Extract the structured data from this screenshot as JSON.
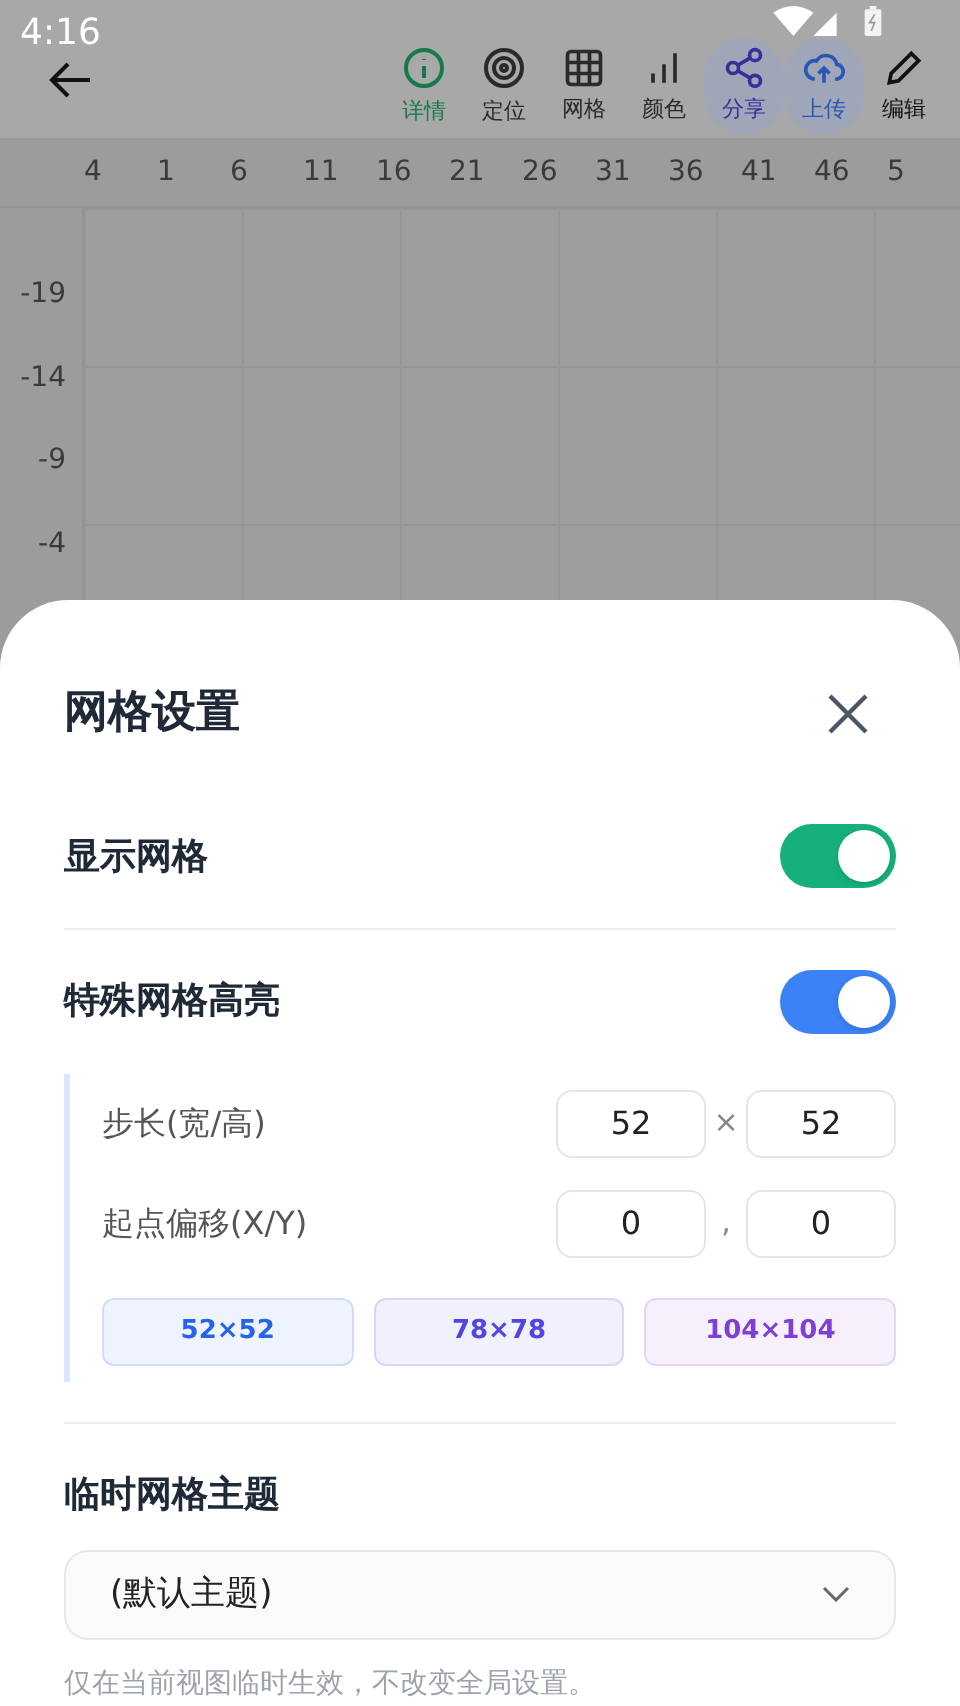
{
  "status_bar": {
    "time": "4:16"
  },
  "toolbar": {
    "items": [
      {
        "label": "详情",
        "color": "#157a47",
        "highlighted": false
      },
      {
        "label": "定位",
        "color": "#2a2a2a",
        "highlighted": false
      },
      {
        "label": "网格",
        "color": "#2a2a2a",
        "highlighted": false
      },
      {
        "label": "颜色",
        "color": "#2a2a2a",
        "highlighted": false
      },
      {
        "label": "分享",
        "color": "#35309a",
        "highlighted": true
      },
      {
        "label": "上传",
        "color": "#2857b8",
        "highlighted": true
      },
      {
        "label": "编辑",
        "color": "#111111",
        "highlighted": false
      }
    ]
  },
  "ruler": {
    "x_labels": [
      "4",
      "1",
      "6",
      "11",
      "16",
      "21",
      "26",
      "31",
      "36",
      "41",
      "46",
      "5"
    ],
    "y_labels": [
      "-19",
      "-14",
      "-9",
      "-4"
    ]
  },
  "sheet": {
    "title": "网格设置",
    "toggles": [
      {
        "label": "显示网格",
        "on": true,
        "color": "#16b07a"
      },
      {
        "label": "特殊网格高亮",
        "on": true,
        "color": "#3b82f6"
      }
    ],
    "step": {
      "label": "步长(宽/高)",
      "first": "52",
      "separator": "×",
      "second": "52"
    },
    "offset": {
      "label": "起点偏移(X/Y)",
      "first": "0",
      "separator": ",",
      "second": "0"
    },
    "presets": [
      {
        "label": "52×52",
        "color": "#2563eb"
      },
      {
        "label": "78×78",
        "color": "#4f46e5"
      },
      {
        "label": "104×104",
        "color": "#7e3fd6"
      }
    ],
    "theme": {
      "label": "临时网格主题",
      "value": "(默认主题)"
    },
    "hint": "仅在当前视图临时生效，不改变全局设置。"
  }
}
